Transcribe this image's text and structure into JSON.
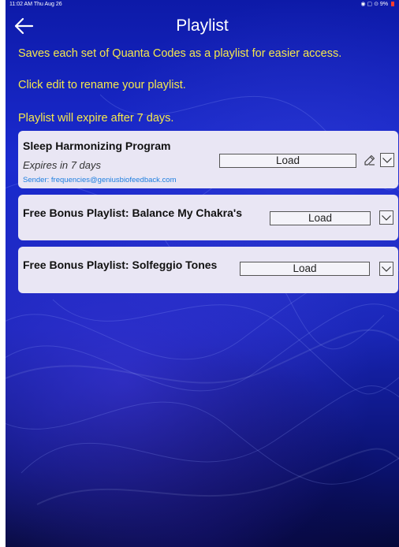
{
  "status_bar": {
    "time": "11:02 AM  Thu Aug 26",
    "indicators": "◉ ▢ ⊙ 9%"
  },
  "header": {
    "back_icon": "left-arrow-icon",
    "title": "Playlist"
  },
  "info": {
    "line1": "Saves each set of Quanta Codes as a playlist for easier access.",
    "line2": "Click edit to rename your playlist.",
    "line3": "Playlist will expire after 7 days."
  },
  "playlists": [
    {
      "name": "Sleep Harmonizing Program",
      "expires": "Expires in 7 days",
      "sender": "Sender: frequencies@geniusbiofeedback.com",
      "load_label": "Load",
      "edit_icon": "pencil-edit-icon",
      "expand_icon": "chevron-down-icon"
    },
    {
      "name": "Free Bonus Playlist: Balance My Chakra's",
      "load_label": "Load",
      "expand_icon": "chevron-down-icon"
    },
    {
      "name": "Free Bonus Playlist: Solfeggio Tones",
      "load_label": "Load",
      "expand_icon": "chevron-down-icon"
    }
  ],
  "colors": {
    "info_text": "#f6e84b",
    "card_bg": "#e9e6f4",
    "sender_link": "#1e7fe0",
    "background": "#1724b5"
  }
}
